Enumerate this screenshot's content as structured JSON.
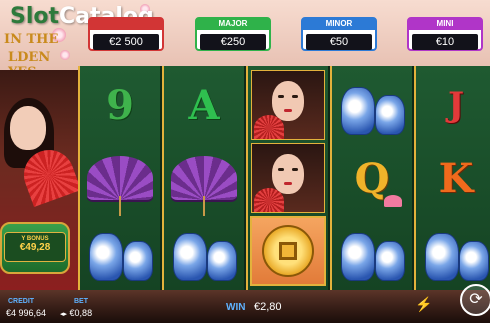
{
  "watermark": {
    "slot": "Slot",
    "catalog": "Catalog"
  },
  "logo": {
    "line1": "IN THE",
    "line2": "LDEN",
    "line3": "YES"
  },
  "jackpots": [
    {
      "label": "",
      "value": "€2 500",
      "color": "#d23535"
    },
    {
      "label": "MAJOR",
      "value": "€250",
      "color": "#2fb24a"
    },
    {
      "label": "MINOR",
      "value": "€50",
      "color": "#2c7ad6"
    },
    {
      "label": "MINI",
      "value": "€10",
      "color": "#b035c8"
    }
  ],
  "pot": {
    "title": "Y BONUS",
    "value": "€49,28"
  },
  "reels": [
    [
      "nine",
      "umbrella",
      "vase"
    ],
    [
      "a",
      "umbrella",
      "vase"
    ],
    [
      "portrait",
      "portrait",
      "coin"
    ],
    [
      "vase",
      "q",
      "vase"
    ],
    [
      "j",
      "k",
      "vase"
    ]
  ],
  "letters": {
    "nine": "9",
    "a": "A",
    "q": "Q",
    "k": "K",
    "j": "J"
  },
  "bottom": {
    "credit_label": "CREDIT",
    "credit_value": "€4 996,64",
    "bet_label": "BET",
    "bet_value": "€0,88",
    "win_label": "WIN",
    "win_value": "€2,80"
  },
  "icons": {
    "bolt": "⚡",
    "spin": "⟳",
    "settings": "⚙",
    "bet_arrows": "◂ ▸"
  }
}
